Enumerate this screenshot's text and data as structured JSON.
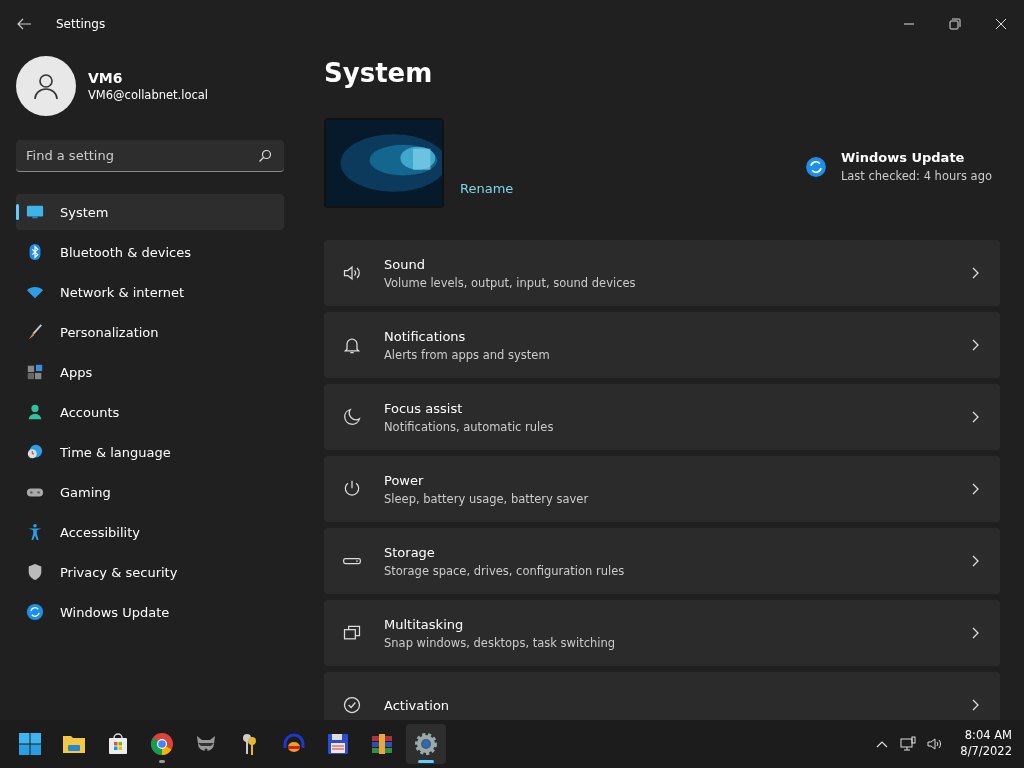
{
  "window": {
    "title": "Settings"
  },
  "account": {
    "name": "VM6",
    "email": "VM6@collabnet.local"
  },
  "search": {
    "placeholder": "Find a setting"
  },
  "nav": [
    {
      "label": "System",
      "kind": "system",
      "selected": true
    },
    {
      "label": "Bluetooth & devices",
      "kind": "bluetooth",
      "selected": false
    },
    {
      "label": "Network & internet",
      "kind": "network",
      "selected": false
    },
    {
      "label": "Personalization",
      "kind": "brush",
      "selected": false
    },
    {
      "label": "Apps",
      "kind": "apps",
      "selected": false
    },
    {
      "label": "Accounts",
      "kind": "accounts",
      "selected": false
    },
    {
      "label": "Time & language",
      "kind": "time",
      "selected": false
    },
    {
      "label": "Gaming",
      "kind": "gaming",
      "selected": false
    },
    {
      "label": "Accessibility",
      "kind": "accessibility",
      "selected": false
    },
    {
      "label": "Privacy & security",
      "kind": "privacy",
      "selected": false
    },
    {
      "label": "Windows Update",
      "kind": "update",
      "selected": false
    }
  ],
  "page": {
    "title": "System",
    "rename": "Rename",
    "update": {
      "title": "Windows Update",
      "status": "Last checked: 4 hours ago"
    }
  },
  "cards": [
    {
      "kind": "sound",
      "title": "Sound",
      "subtitle": "Volume levels, output, input, sound devices"
    },
    {
      "kind": "notifications",
      "title": "Notifications",
      "subtitle": "Alerts from apps and system"
    },
    {
      "kind": "focus",
      "title": "Focus assist",
      "subtitle": "Notifications, automatic rules"
    },
    {
      "kind": "power",
      "title": "Power",
      "subtitle": "Sleep, battery usage, battery saver"
    },
    {
      "kind": "storage",
      "title": "Storage",
      "subtitle": "Storage space, drives, configuration rules"
    },
    {
      "kind": "multitasking",
      "title": "Multitasking",
      "subtitle": "Snap windows, desktops, task switching"
    },
    {
      "kind": "activation",
      "title": "Activation"
    }
  ],
  "taskbar": {
    "apps": [
      {
        "kind": "start",
        "running": false,
        "active": false
      },
      {
        "kind": "explorer",
        "running": false,
        "active": false
      },
      {
        "kind": "store",
        "running": false,
        "active": false
      },
      {
        "kind": "chrome",
        "running": true,
        "active": false
      },
      {
        "kind": "raccoon",
        "running": false,
        "active": false
      },
      {
        "kind": "keys",
        "running": false,
        "active": false
      },
      {
        "kind": "headphones",
        "running": false,
        "active": false
      },
      {
        "kind": "floppy",
        "running": false,
        "active": false
      },
      {
        "kind": "archive",
        "running": false,
        "active": false
      },
      {
        "kind": "settings",
        "running": true,
        "active": true
      }
    ],
    "time": "8:04 AM",
    "date": "8/7/2022"
  }
}
